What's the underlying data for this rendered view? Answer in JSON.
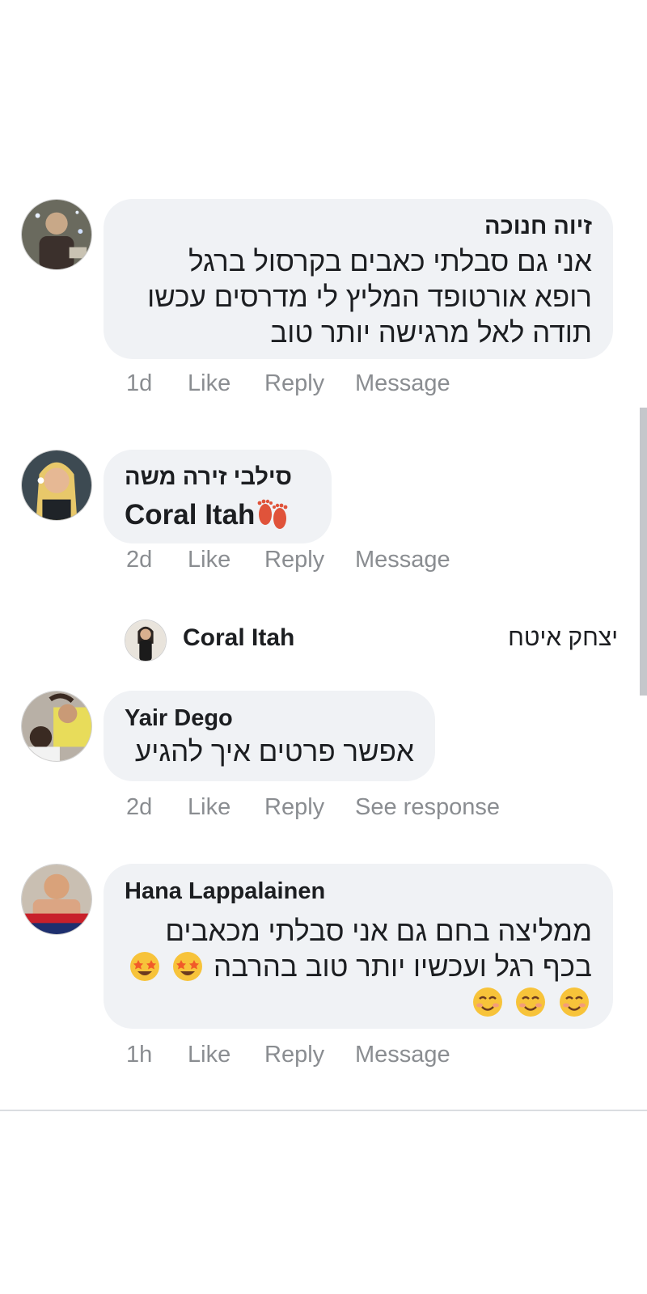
{
  "comments": [
    {
      "author": "זיוה חנוכה",
      "text": "אני גם סבלתי כאבים בקרסול ברגל רופא אורטופד המליץ לי מדרסים עכשו תודה לאל מרגישה יותר טוב",
      "time": "1d",
      "like": "Like",
      "reply": "Reply",
      "third_action": "Message"
    },
    {
      "author": "סילבי זירה משה",
      "mention": "Coral Itah",
      "emoji_icon": "footprints-icon",
      "time": "2d",
      "like": "Like",
      "reply": "Reply",
      "third_action": "Message"
    },
    {
      "author": "Yair Dego",
      "text": "אפשר פרטים איך להגיע",
      "time": "2d",
      "like": "Like",
      "reply": "Reply",
      "third_action": "See response"
    },
    {
      "author": "Hana Lappalainen",
      "text": "ממליצה בחם גם אני סבלתי מכאבים בכף רגל ועכשיו יותר טוב בהרבה",
      "emoji_icons": [
        "star-struck-icon",
        "star-struck-icon",
        "smiling-face-icon",
        "smiling-face-icon",
        "smiling-face-icon"
      ],
      "time": "1h",
      "like": "Like",
      "reply": "Reply",
      "third_action": "Message"
    }
  ],
  "reply_preview": {
    "author": "Coral Itah",
    "text": "יצחק איטח"
  },
  "colors": {
    "bubble": "#f0f2f5",
    "text": "#1c1e21",
    "meta": "#8a8d91",
    "scrollbar": "#c5c7cb"
  }
}
